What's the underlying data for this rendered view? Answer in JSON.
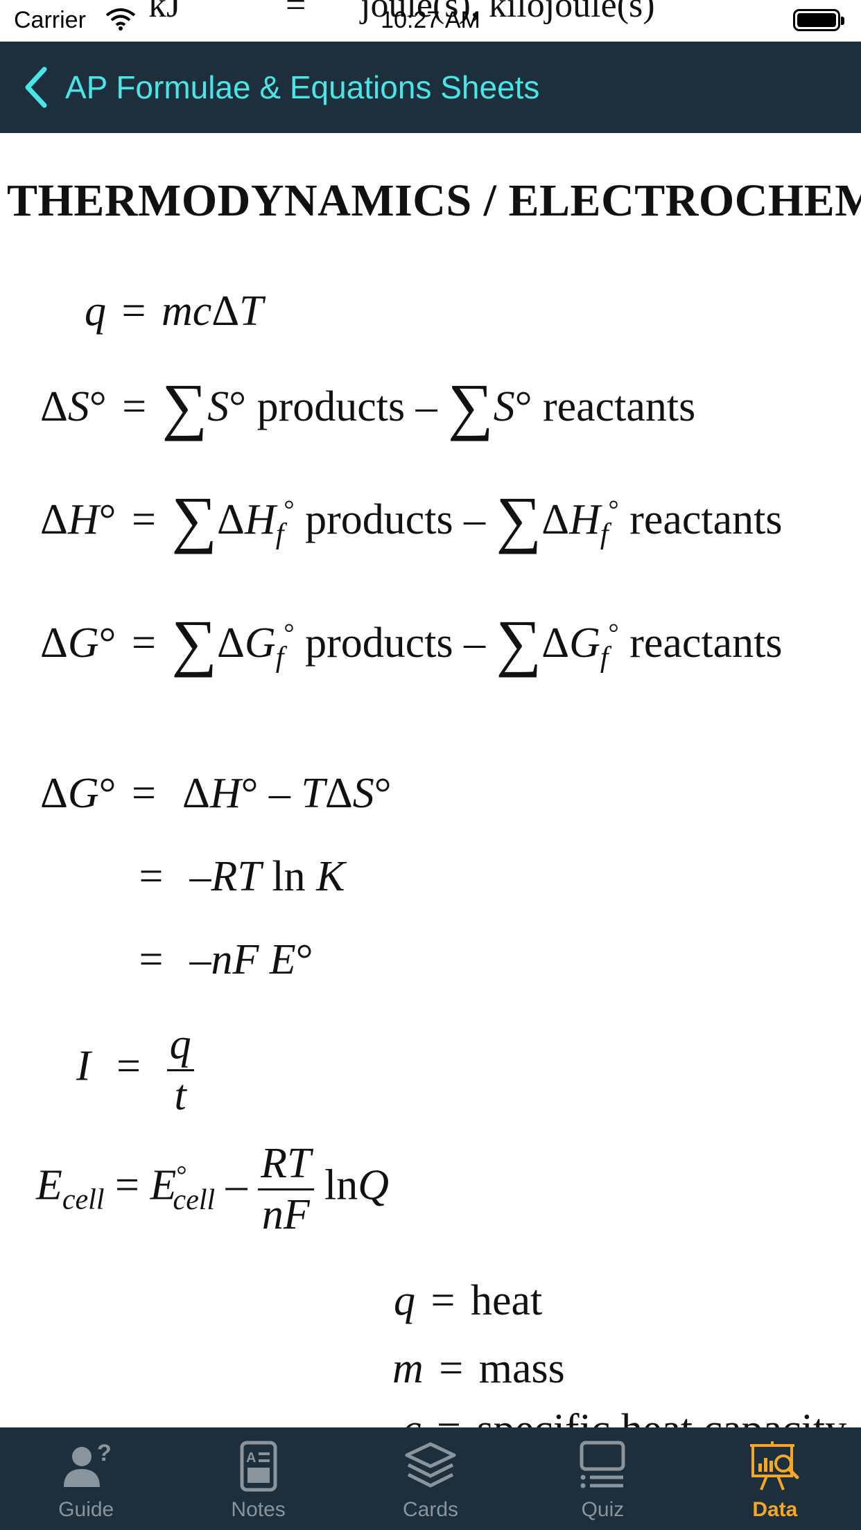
{
  "status_bar": {
    "carrier": "Carrier",
    "time": "10:27 AM",
    "bleed_left": "kJ",
    "bleed_mid": "=",
    "bleed_right": "joule(s), kilojoule(s)"
  },
  "nav": {
    "title": "AP Formulae & Equations Sheets",
    "tint_color": "#48e6e6",
    "bar_color": "#1d2e3c"
  },
  "document": {
    "section_title": "THERMODYNAMICS / ELECTROCHEMISTRY",
    "words": {
      "products": "products",
      "reactants": "reactants",
      "ln": "ln",
      "cell": "cell",
      "heat": "heat",
      "mass": "mass",
      "specific_heat": "specific heat capacity"
    }
  },
  "tabs": [
    {
      "label": "Guide",
      "icon": "person-question-icon",
      "active": false
    },
    {
      "label": "Notes",
      "icon": "notes-icon",
      "active": false
    },
    {
      "label": "Cards",
      "icon": "cards-stack-icon",
      "active": false
    },
    {
      "label": "Quiz",
      "icon": "quiz-list-icon",
      "active": false
    },
    {
      "label": "Data",
      "icon": "data-chart-icon",
      "active": true
    }
  ],
  "colors": {
    "active_tab": "#f5a623",
    "inactive_tab": "#8a949c"
  }
}
